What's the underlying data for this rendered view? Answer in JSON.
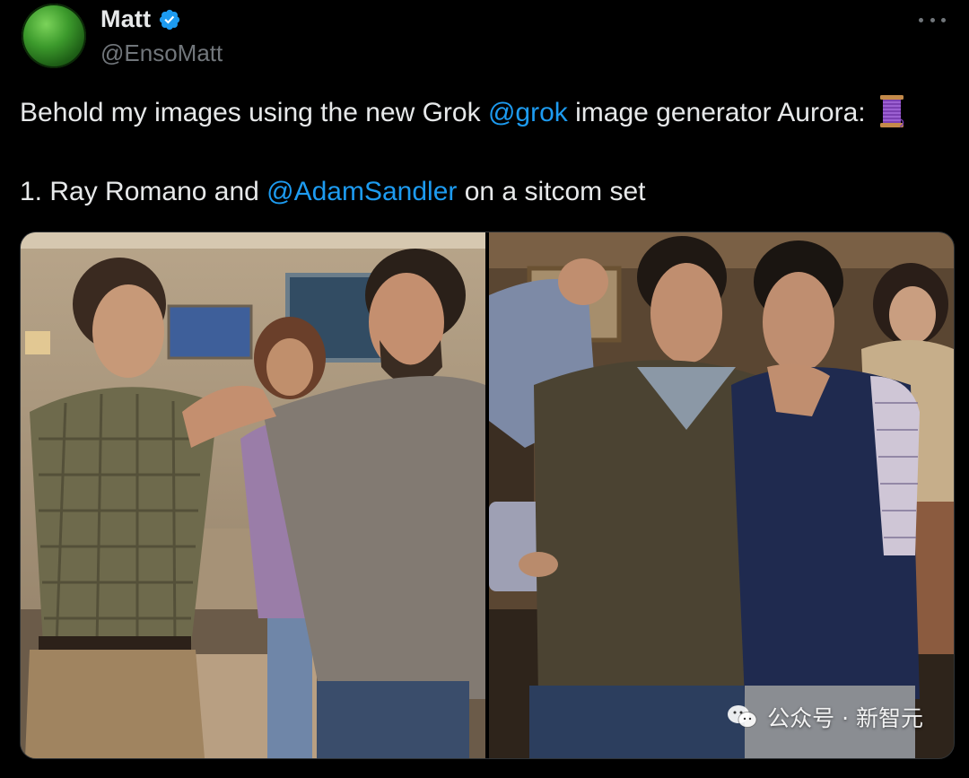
{
  "author": {
    "display_name": "Matt",
    "handle": "@EnsoMatt",
    "verified": true,
    "avatar_icon": "green-sphere-avatar"
  },
  "menu": {
    "icon": "more-horizontal-icon"
  },
  "text": {
    "line1_before": "Behold my images using the new Grok ",
    "line1_mention": "@grok",
    "line1_after": " image generator Aurora: ",
    "line1_emoji": "spool-of-thread-icon",
    "line2_before": "1. Ray Romano and ",
    "line2_mention": "@AdamSandler",
    "line2_after": " on a sitcom set"
  },
  "media": {
    "images": [
      {
        "name": "image-sitcom-living-room-1"
      },
      {
        "name": "image-sitcom-living-room-2"
      }
    ],
    "watermark": "公众号 · 新智元"
  },
  "colors": {
    "background": "#000000",
    "text": "#e7e9ea",
    "secondary": "#71767b",
    "link": "#1d9bf0",
    "verified": "#1d9bf0"
  }
}
